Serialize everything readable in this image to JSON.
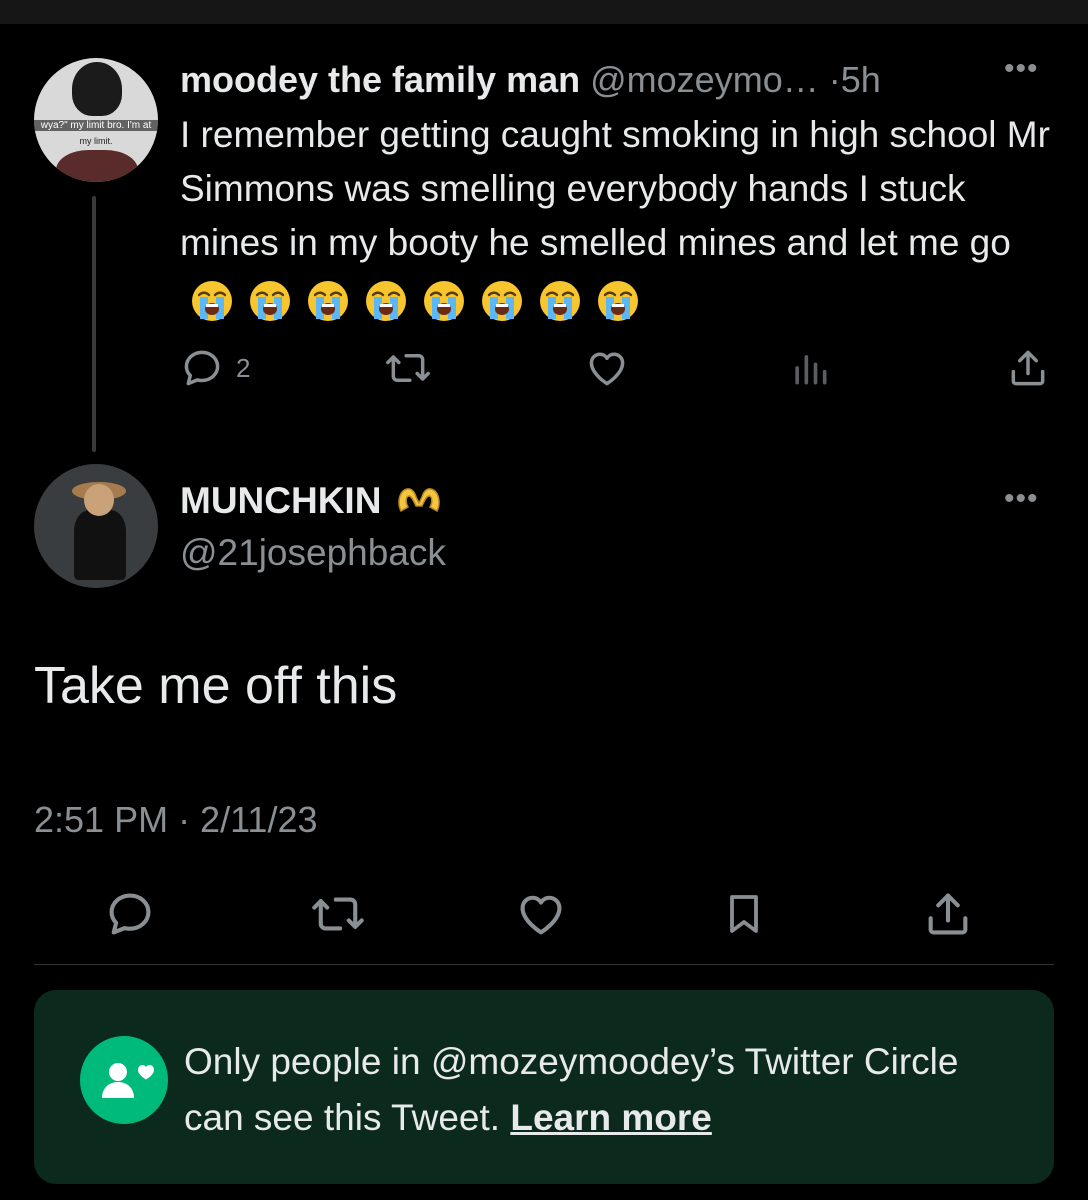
{
  "parent_tweet": {
    "author_name": "moodey the family man",
    "author_handle": "@mozeymo…",
    "separator": "·",
    "time": "5h",
    "avatar_caption_1": "wya?\" my limit bro. I'm at",
    "avatar_caption_2": "my limit.",
    "more_label": "•••",
    "text": "I remember getting caught smoking in high school Mr Simmons was smelling everybody hands I stuck mines in my booty he smelled mines and let me go",
    "emoji_icon": "loudly-crying-face",
    "emoji_count": 8,
    "reply_count": "2"
  },
  "main_tweet": {
    "author_name": "MUNCHKIN",
    "name_emoji_icon": "heart-hands-icon",
    "author_handle": "@21josephback",
    "more_label": "•••",
    "text": "Take me off this",
    "timestamp": "2:51 PM · 2/11/23"
  },
  "circle_notice": {
    "text": "Only people in @mozeymoodey’s Twitter Circle can see this Tweet.",
    "link_label": "Learn more"
  },
  "colors": {
    "background": "#000000",
    "text": "#e7e9ea",
    "muted": "#8a8f94",
    "circle_green": "#00ba7c",
    "circle_bg": "#0b2a1d"
  }
}
